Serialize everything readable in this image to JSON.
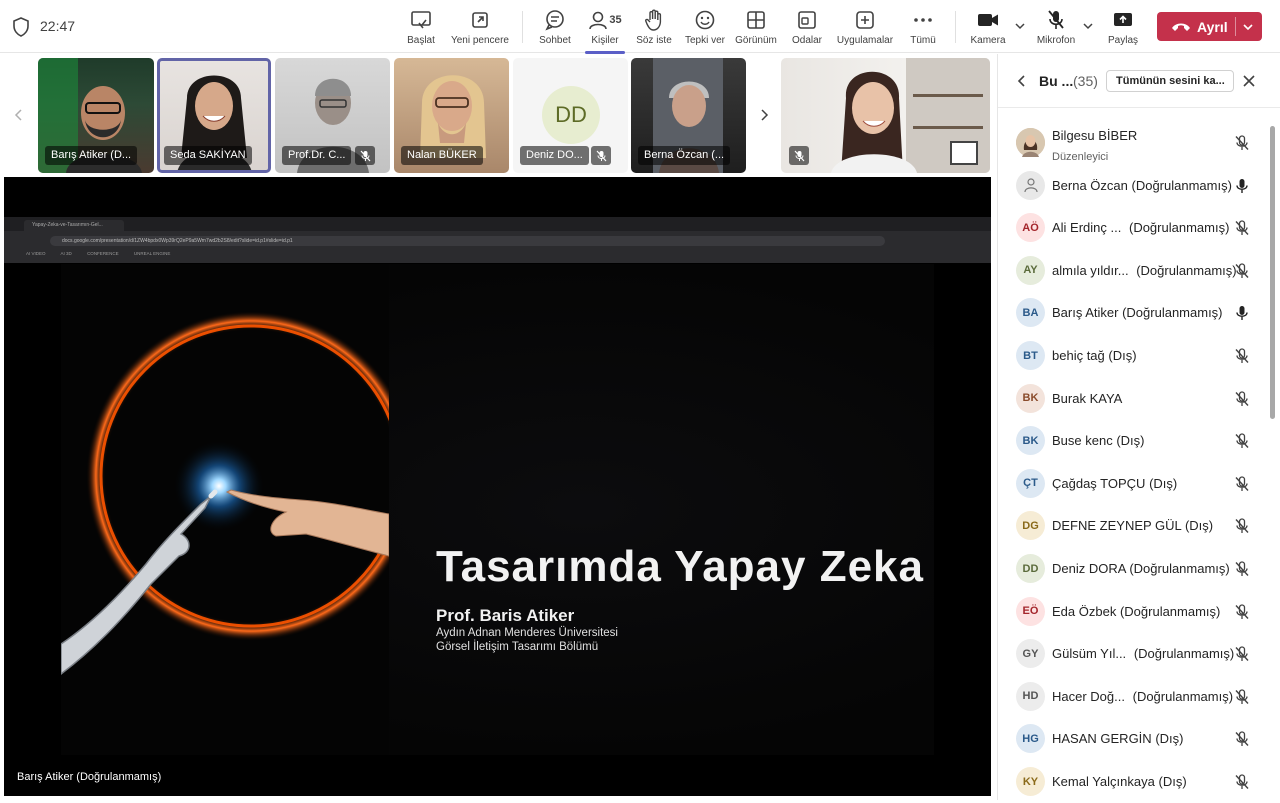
{
  "clock": "22:47",
  "toolbar": {
    "start": "Başlat",
    "new_window": "Yeni pencere",
    "chat": "Sohbet",
    "people": "Kişiler",
    "people_count": "35",
    "raise_hand": "Söz iste",
    "react": "Tepki ver",
    "view": "Görünüm",
    "rooms": "Odalar",
    "apps": "Uygulamalar",
    "more": "Tümü",
    "camera": "Kamera",
    "mic": "Mikrofon",
    "share": "Paylaş",
    "leave": "Ayrıl"
  },
  "tiles": [
    {
      "name": "Barış Atiker (D..."
    },
    {
      "name": "Seda SAKİYAN"
    },
    {
      "name": "Prof.Dr. C..."
    },
    {
      "name": "Nalan BÜKER"
    },
    {
      "name": "Deniz DO...",
      "initials": "DD"
    },
    {
      "name": "Berna Özcan (..."
    }
  ],
  "slide": {
    "tab_title": "Yapay-Zeka-ve-Tasarımın-Gel...",
    "url": "docs.google.com/presentation/d/1ZW4bpdx0Wp39rQ2eP9a5Wm7wd2b2S8/edit?slide=id.p1#slide=id.p1",
    "bookmarks": [
      "AI VIDEO",
      "AI 3D",
      "CONFERENCE",
      "UNREAL ENGINE"
    ],
    "title": "Tasarımda Yapay Zeka",
    "author": "Prof. Baris Atiker",
    "line1": "Aydın Adnan Menderes Üniversitesi",
    "line2": "Görsel İletişim Tasarımı Bölümü"
  },
  "presenter_label": "Barış Atiker (Doğrulanmamış)",
  "panel": {
    "title": "Bu ...",
    "count": "(35)",
    "mute_all": "Tümünün sesini ka...",
    "participants": [
      {
        "initials": "",
        "name": "Bilgesu BİBER",
        "tag": "",
        "sub": "Düzenleyici",
        "mic": "off",
        "bg": "#c9b79c",
        "fg": "#4a3b2a"
      },
      {
        "initials": "",
        "name": "Berna Özcan",
        "tag": "(Doğrulanmamış)",
        "sub": "",
        "mic": "on",
        "bg": "#e8e8e8",
        "fg": "#777777"
      },
      {
        "initials": "AÖ",
        "name": "Ali Erdinç ...",
        "tag": "(Doğrulanmamış)",
        "sub": "",
        "mic": "off",
        "bg": "#fde2e2",
        "fg": "#a4262c"
      },
      {
        "initials": "AY",
        "name": "almıla yıldır...",
        "tag": "(Doğrulanmamış)",
        "sub": "",
        "mic": "off",
        "bg": "#e6ecdc",
        "fg": "#5b6b3b"
      },
      {
        "initials": "BA",
        "name": "Barış Atiker",
        "tag": "(Doğrulanmamış)",
        "sub": "",
        "mic": "on",
        "bg": "#dde8f3",
        "fg": "#2b5a8a"
      },
      {
        "initials": "BT",
        "name": "behiç tağ",
        "tag": "(Dış)",
        "sub": "",
        "mic": "off",
        "bg": "#dde8f3",
        "fg": "#2b5a8a"
      },
      {
        "initials": "BK",
        "name": "Burak KAYA",
        "tag": "",
        "sub": "",
        "mic": "off",
        "bg": "#f3e3db",
        "fg": "#8a4b2b"
      },
      {
        "initials": "BK",
        "name": "Buse kenc",
        "tag": "(Dış)",
        "sub": "",
        "mic": "off",
        "bg": "#dde8f3",
        "fg": "#2b5a8a"
      },
      {
        "initials": "ÇT",
        "name": "Çağdaş TOPÇU",
        "tag": "(Dış)",
        "sub": "",
        "mic": "off",
        "bg": "#dde8f3",
        "fg": "#2b5a8a"
      },
      {
        "initials": "DG",
        "name": "DEFNE ZEYNEP GÜL",
        "tag": "(Dış)",
        "sub": "",
        "mic": "off",
        "bg": "#f6ecd5",
        "fg": "#8a6a1a"
      },
      {
        "initials": "DD",
        "name": "Deniz DORA",
        "tag": "(Doğrulanmamış)",
        "sub": "",
        "mic": "off",
        "bg": "#e6ecdc",
        "fg": "#5b6b3b"
      },
      {
        "initials": "EÖ",
        "name": "Eda Özbek",
        "tag": "(Doğrulanmamış)",
        "sub": "",
        "mic": "off",
        "bg": "#fde2e2",
        "fg": "#a4262c"
      },
      {
        "initials": "GY",
        "name": "Gülsüm Yıl...",
        "tag": "(Doğrulanmamış)",
        "sub": "",
        "mic": "off",
        "bg": "#ececec",
        "fg": "#555555"
      },
      {
        "initials": "HD",
        "name": "Hacer Doğ...",
        "tag": "(Doğrulanmamış)",
        "sub": "",
        "mic": "off",
        "bg": "#ececec",
        "fg": "#555555"
      },
      {
        "initials": "HG",
        "name": "HASAN GERGİN",
        "tag": "(Dış)",
        "sub": "",
        "mic": "off",
        "bg": "#dde8f3",
        "fg": "#2b5a8a"
      },
      {
        "initials": "KY",
        "name": "Kemal Yalçınkaya",
        "tag": "(Dış)",
        "sub": "",
        "mic": "off",
        "bg": "#f6ecd5",
        "fg": "#8a6a1a"
      }
    ]
  }
}
